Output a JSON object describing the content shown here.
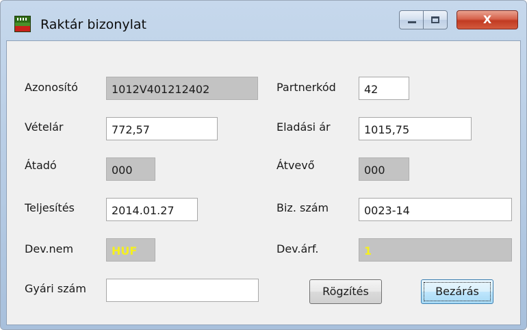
{
  "window": {
    "title": "Raktár bizonylat",
    "close_symbol": "X",
    "icon": "app-grid-icon"
  },
  "form": {
    "azonosito": {
      "label": "Azonosító",
      "value": "1012V401212402"
    },
    "partnerkod": {
      "label": "Partnerkód",
      "value": "42"
    },
    "vetelar": {
      "label": "Vételár",
      "value": "772,57"
    },
    "eladasi_ar": {
      "label": "Eladási ár",
      "value": "1015,75"
    },
    "atado": {
      "label": "Átadó",
      "value": "000"
    },
    "atvevo": {
      "label": "Átvevő",
      "value": "000"
    },
    "teljesites": {
      "label": "Teljesítés",
      "value": "2014.01.27"
    },
    "biz_szam": {
      "label": "Biz. szám",
      "value": "0023-14"
    },
    "dev_nem": {
      "label": "Dev.nem",
      "value": "HUF"
    },
    "dev_arf": {
      "label": "Dev.árf.",
      "value": "1"
    },
    "gyari_szam": {
      "label": "Gyári szám",
      "value": ""
    }
  },
  "buttons": {
    "rogzites": "Rögzítés",
    "bezaras": "Bezárás"
  },
  "colors": {
    "readonly_bg": "#c3c3c3",
    "currency_text": "#f5f01e",
    "close_button": "#c13b22"
  }
}
